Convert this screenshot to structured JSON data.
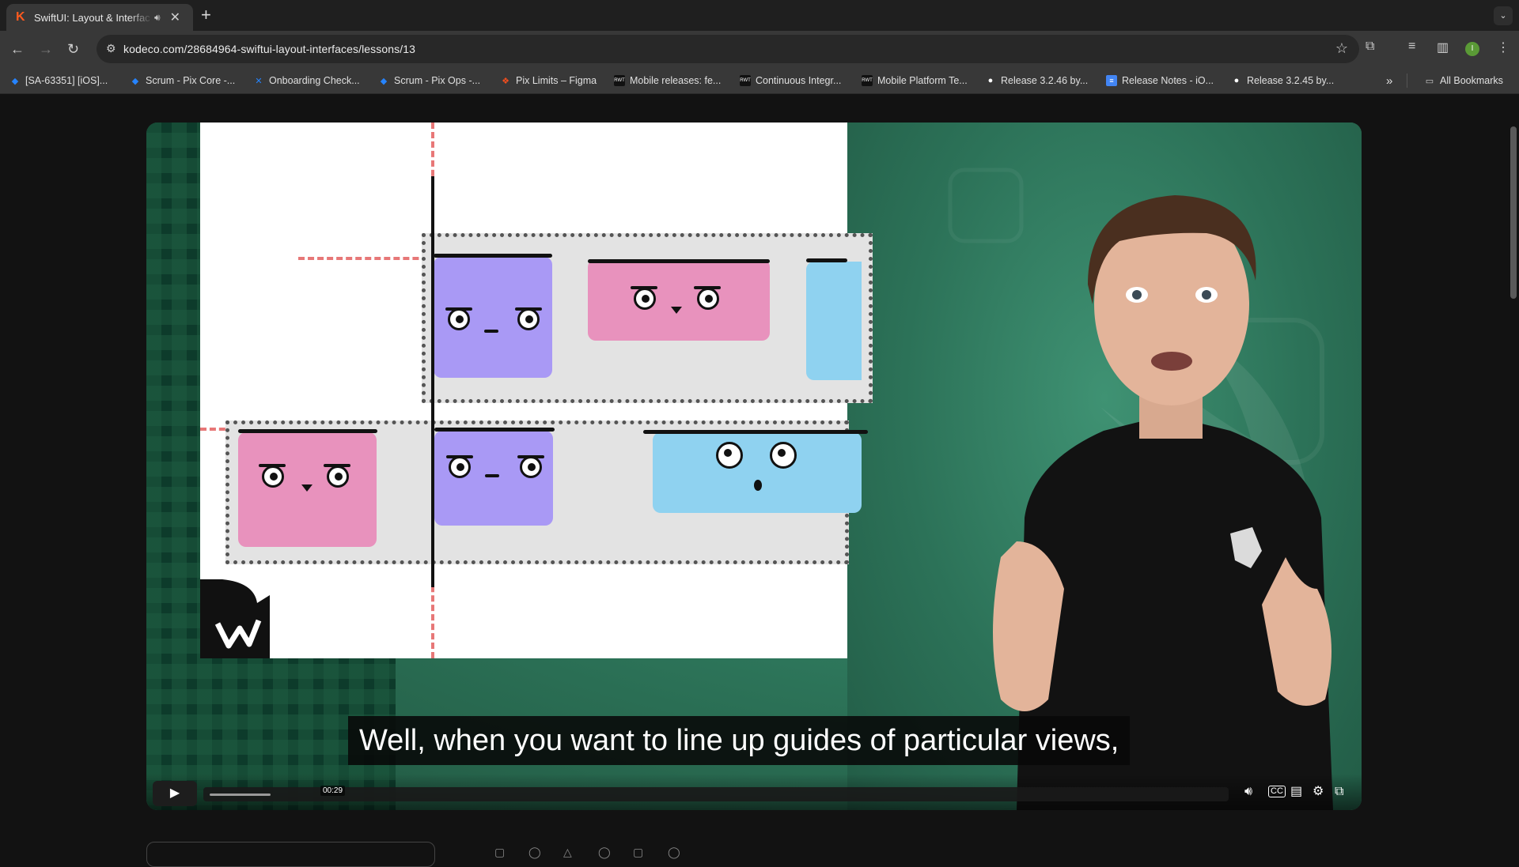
{
  "browser": {
    "tab": {
      "title": "SwiftUI: Layout & Interfac",
      "favicon": "kodeco-k-icon"
    },
    "url": "kodeco.com/28684964-swiftui-layout-interfaces/lessons/13",
    "profile_initial": "I",
    "bookmarks": [
      {
        "label": "[SA-63351] [iOS]...",
        "icon": "jira-icon"
      },
      {
        "label": "Scrum - Pix Core -...",
        "icon": "jira-icon"
      },
      {
        "label": "Onboarding Check...",
        "icon": "confluence-icon"
      },
      {
        "label": "Scrum - Pix Ops -...",
        "icon": "jira-icon"
      },
      {
        "label": "Pix Limits – Figma",
        "icon": "figma-icon"
      },
      {
        "label": "Mobile releases: fe...",
        "icon": "app-icon"
      },
      {
        "label": "Continuous Integr...",
        "icon": "app-icon"
      },
      {
        "label": "Mobile Platform Te...",
        "icon": "app-icon"
      },
      {
        "label": "Release 3.2.46 by...",
        "icon": "github-icon"
      },
      {
        "label": "Release Notes - iO...",
        "icon": "docs-icon"
      },
      {
        "label": "Release 3.2.45 by...",
        "icon": "github-icon"
      }
    ],
    "overflow_label": "»",
    "all_bookmarks_label": "All Bookmarks"
  },
  "video": {
    "caption": "Well, when you want to line up guides of particular views,",
    "hover_time": "00:29",
    "progress": 0.06,
    "colors": {
      "whiteboard": "#ffffff",
      "green": "#2f7a5e",
      "pink": "#e892bd",
      "purple": "#a999f5",
      "blue": "#8fd2f0",
      "guide": "#e04a4a"
    }
  }
}
